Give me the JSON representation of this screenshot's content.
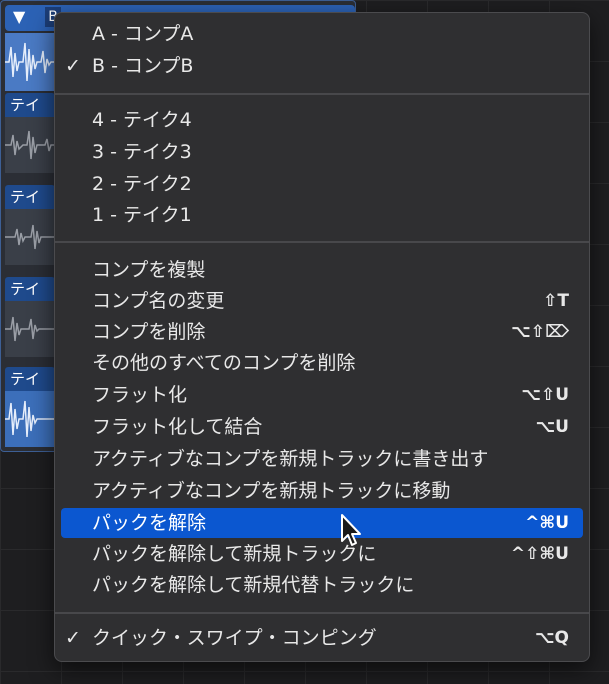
{
  "take_folder": {
    "header_letter": "B",
    "take_label": "テイ"
  },
  "menu": {
    "comps": [
      {
        "label": "A - コンプA",
        "checked": false
      },
      {
        "label": "B - コンプB",
        "checked": true
      }
    ],
    "takes": [
      {
        "label": "4 - テイク4"
      },
      {
        "label": "3 - テイク3"
      },
      {
        "label": "2 - テイク2"
      },
      {
        "label": "1 - テイク1"
      }
    ],
    "actions": [
      {
        "label": "コンプを複製",
        "shortcut": ""
      },
      {
        "label": "コンプ名の変更",
        "shortcut": "⇧T"
      },
      {
        "label": "コンプを削除",
        "shortcut": "⌥⇧⌦"
      },
      {
        "label": "その他のすべてのコンプを削除",
        "shortcut": ""
      },
      {
        "label": "フラット化",
        "shortcut": "⌥⇧U"
      },
      {
        "label": "フラット化して結合",
        "shortcut": "⌥U"
      },
      {
        "label": "アクティブなコンプを新規トラックに書き出す",
        "shortcut": ""
      },
      {
        "label": "アクティブなコンプを新規トラックに移動",
        "shortcut": ""
      },
      {
        "label": "パックを解除",
        "shortcut": "^⌘U",
        "highlighted": true
      },
      {
        "label": "パックを解除して新規トラックに",
        "shortcut": "^⇧⌘U"
      },
      {
        "label": "パックを解除して新規代替トラックに",
        "shortcut": ""
      }
    ],
    "quick_swipe": {
      "label": "クイック・スワイプ・コンピング",
      "shortcut": "⌥Q",
      "checked": true
    },
    "check_glyph": "✓"
  },
  "colors": {
    "highlight": "#0b57d0",
    "menu_bg": "#2f2f31",
    "track_blue": "#2c62b5"
  }
}
